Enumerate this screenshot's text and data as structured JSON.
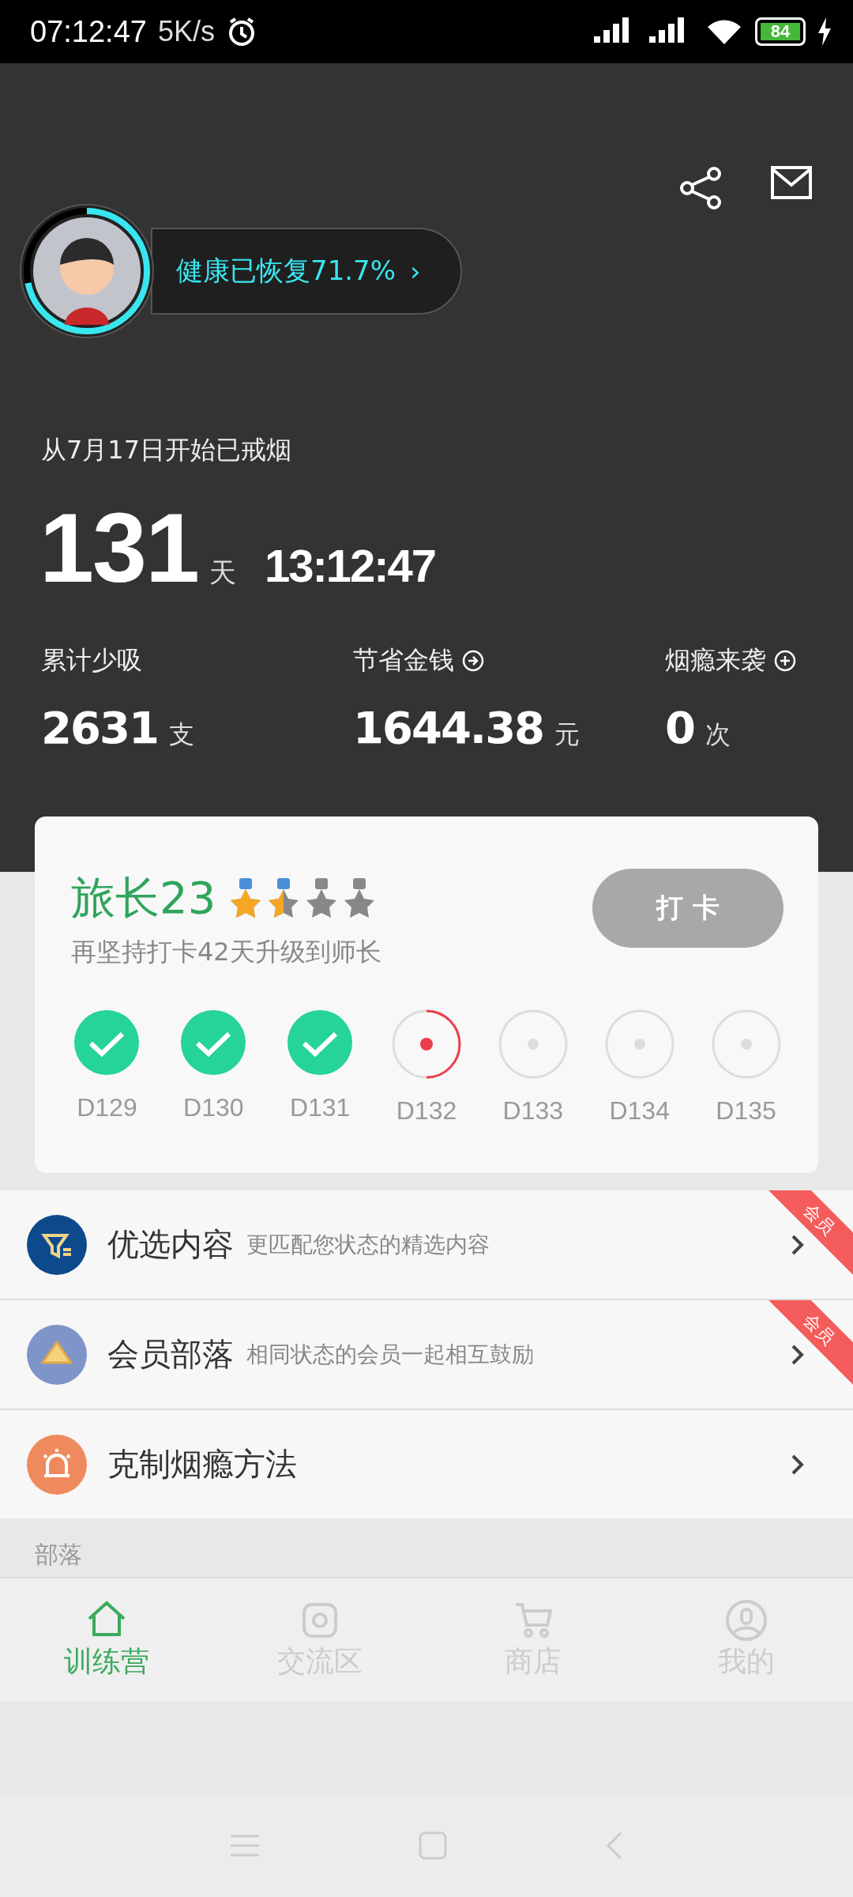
{
  "status_bar": {
    "time": "07:12:47",
    "speed": "5K/s",
    "battery": "84"
  },
  "health": {
    "label": "健康已恢复71.7%",
    "level": 0.717,
    "arrow": "›"
  },
  "quit_since": "从7月17日开始已戒烟",
  "duration": {
    "days": "131",
    "days_unit": "天",
    "clock": "13:12:47"
  },
  "stats": [
    {
      "label": "累计少吸",
      "value": "2631",
      "unit": "支",
      "kind": "plain"
    },
    {
      "label": "节省金钱",
      "value": "1644.38",
      "unit": "元",
      "kind": "arrow"
    },
    {
      "label": "烟瘾来袭",
      "value": "0",
      "unit": "次",
      "kind": "plus"
    }
  ],
  "rank": {
    "title": "旅长23",
    "stars": 1.5,
    "hint": "再坚持打卡42天升级到师长",
    "button": "打 卡"
  },
  "days": [
    {
      "label": "D129",
      "kind": "done"
    },
    {
      "label": "D130",
      "kind": "done"
    },
    {
      "label": "D131",
      "kind": "done"
    },
    {
      "label": "D132",
      "kind": "current"
    },
    {
      "label": "D133",
      "kind": "pending"
    },
    {
      "label": "D134",
      "kind": "pending"
    },
    {
      "label": "D135",
      "kind": "pending"
    }
  ],
  "menu": [
    {
      "title": "优选内容",
      "subtitle": "更匹配您状态的精选内容",
      "badge": "会员",
      "color": "#0d4a8c",
      "kind": "filter"
    },
    {
      "title": "会员部落",
      "subtitle": "相同状态的会员一起相互鼓励",
      "badge": "会员",
      "color": "#7f95c9",
      "kind": "tribe"
    },
    {
      "title": "克制烟瘾方法",
      "color": "#ef8a5e",
      "kind": "alarm"
    }
  ],
  "section_title": "部落",
  "tabs": [
    {
      "label": "训练营",
      "selected": true,
      "kind": "home"
    },
    {
      "label": "交流区",
      "selected": false,
      "kind": "camera"
    },
    {
      "label": "商店",
      "selected": false,
      "kind": "cart"
    },
    {
      "label": "我的",
      "selected": false,
      "kind": "user"
    }
  ]
}
